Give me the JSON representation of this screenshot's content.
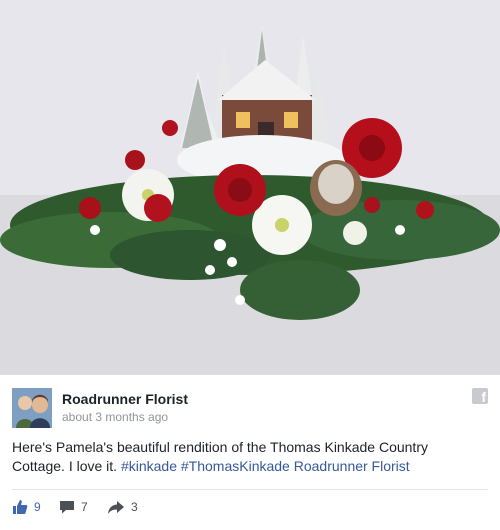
{
  "post": {
    "author": "Roadrunner Florist",
    "timestamp": "about 3 months ago",
    "text_plain": "Here's Pamela's beautiful rendition of the Thomas Kinkade Country Cottage. I love it.",
    "hashtag_1": "#kinkade",
    "hashtag_2": "#ThomasKinkade",
    "mention": "Roadrunner Florist"
  },
  "reactions": {
    "likes": "9",
    "comments": "7",
    "shares": "3"
  },
  "colors": {
    "link": "#365899",
    "like_blue": "#4267b2",
    "text": "#1d2129",
    "meta": "#90949c"
  },
  "icons": {
    "like": "thumbs-up-icon",
    "comment": "comment-bubble-icon",
    "share": "share-arrow-icon",
    "network": "facebook-icon"
  }
}
